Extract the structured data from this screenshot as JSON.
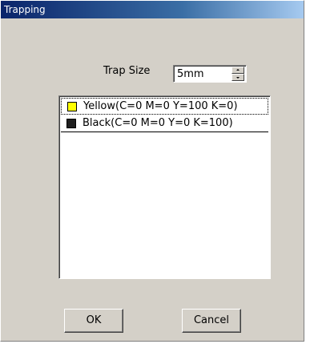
{
  "window": {
    "title": "Trapping"
  },
  "trap_size": {
    "label": "Trap Size",
    "value": "5mm"
  },
  "colors": [
    {
      "label": "Yellow(C=0 M=0 Y=100 K=0)",
      "swatch": "#ffff00"
    },
    {
      "label": "Black(C=0 M=0 Y=0 K=100)",
      "swatch": "#1e1e1e"
    }
  ],
  "buttons": {
    "ok": "OK",
    "cancel": "Cancel"
  }
}
